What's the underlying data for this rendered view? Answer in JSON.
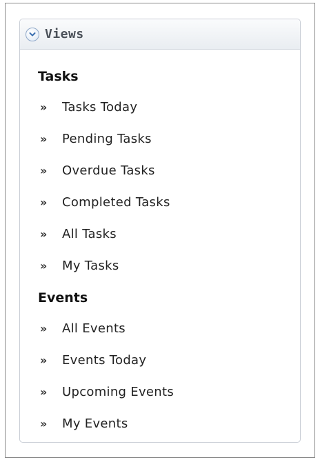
{
  "panel": {
    "title": "Views",
    "toggle_icon": "chevron-down-circle-icon"
  },
  "sections": [
    {
      "heading": "Tasks",
      "items": [
        {
          "label": "Tasks Today"
        },
        {
          "label": "Pending Tasks"
        },
        {
          "label": "Overdue Tasks"
        },
        {
          "label": "Completed Tasks"
        },
        {
          "label": "All Tasks"
        },
        {
          "label": "My Tasks"
        }
      ]
    },
    {
      "heading": "Events",
      "items": [
        {
          "label": "All Events"
        },
        {
          "label": "Events Today"
        },
        {
          "label": "Upcoming Events"
        },
        {
          "label": "My Events"
        }
      ]
    }
  ],
  "bullet_glyph": "»",
  "colors": {
    "panel_border": "#c9ced6",
    "header_gradient_top": "#fafbfc",
    "header_gradient_bottom": "#e9edf1",
    "title_text": "#4a5058",
    "icon_accent": "#3a6fb0"
  }
}
